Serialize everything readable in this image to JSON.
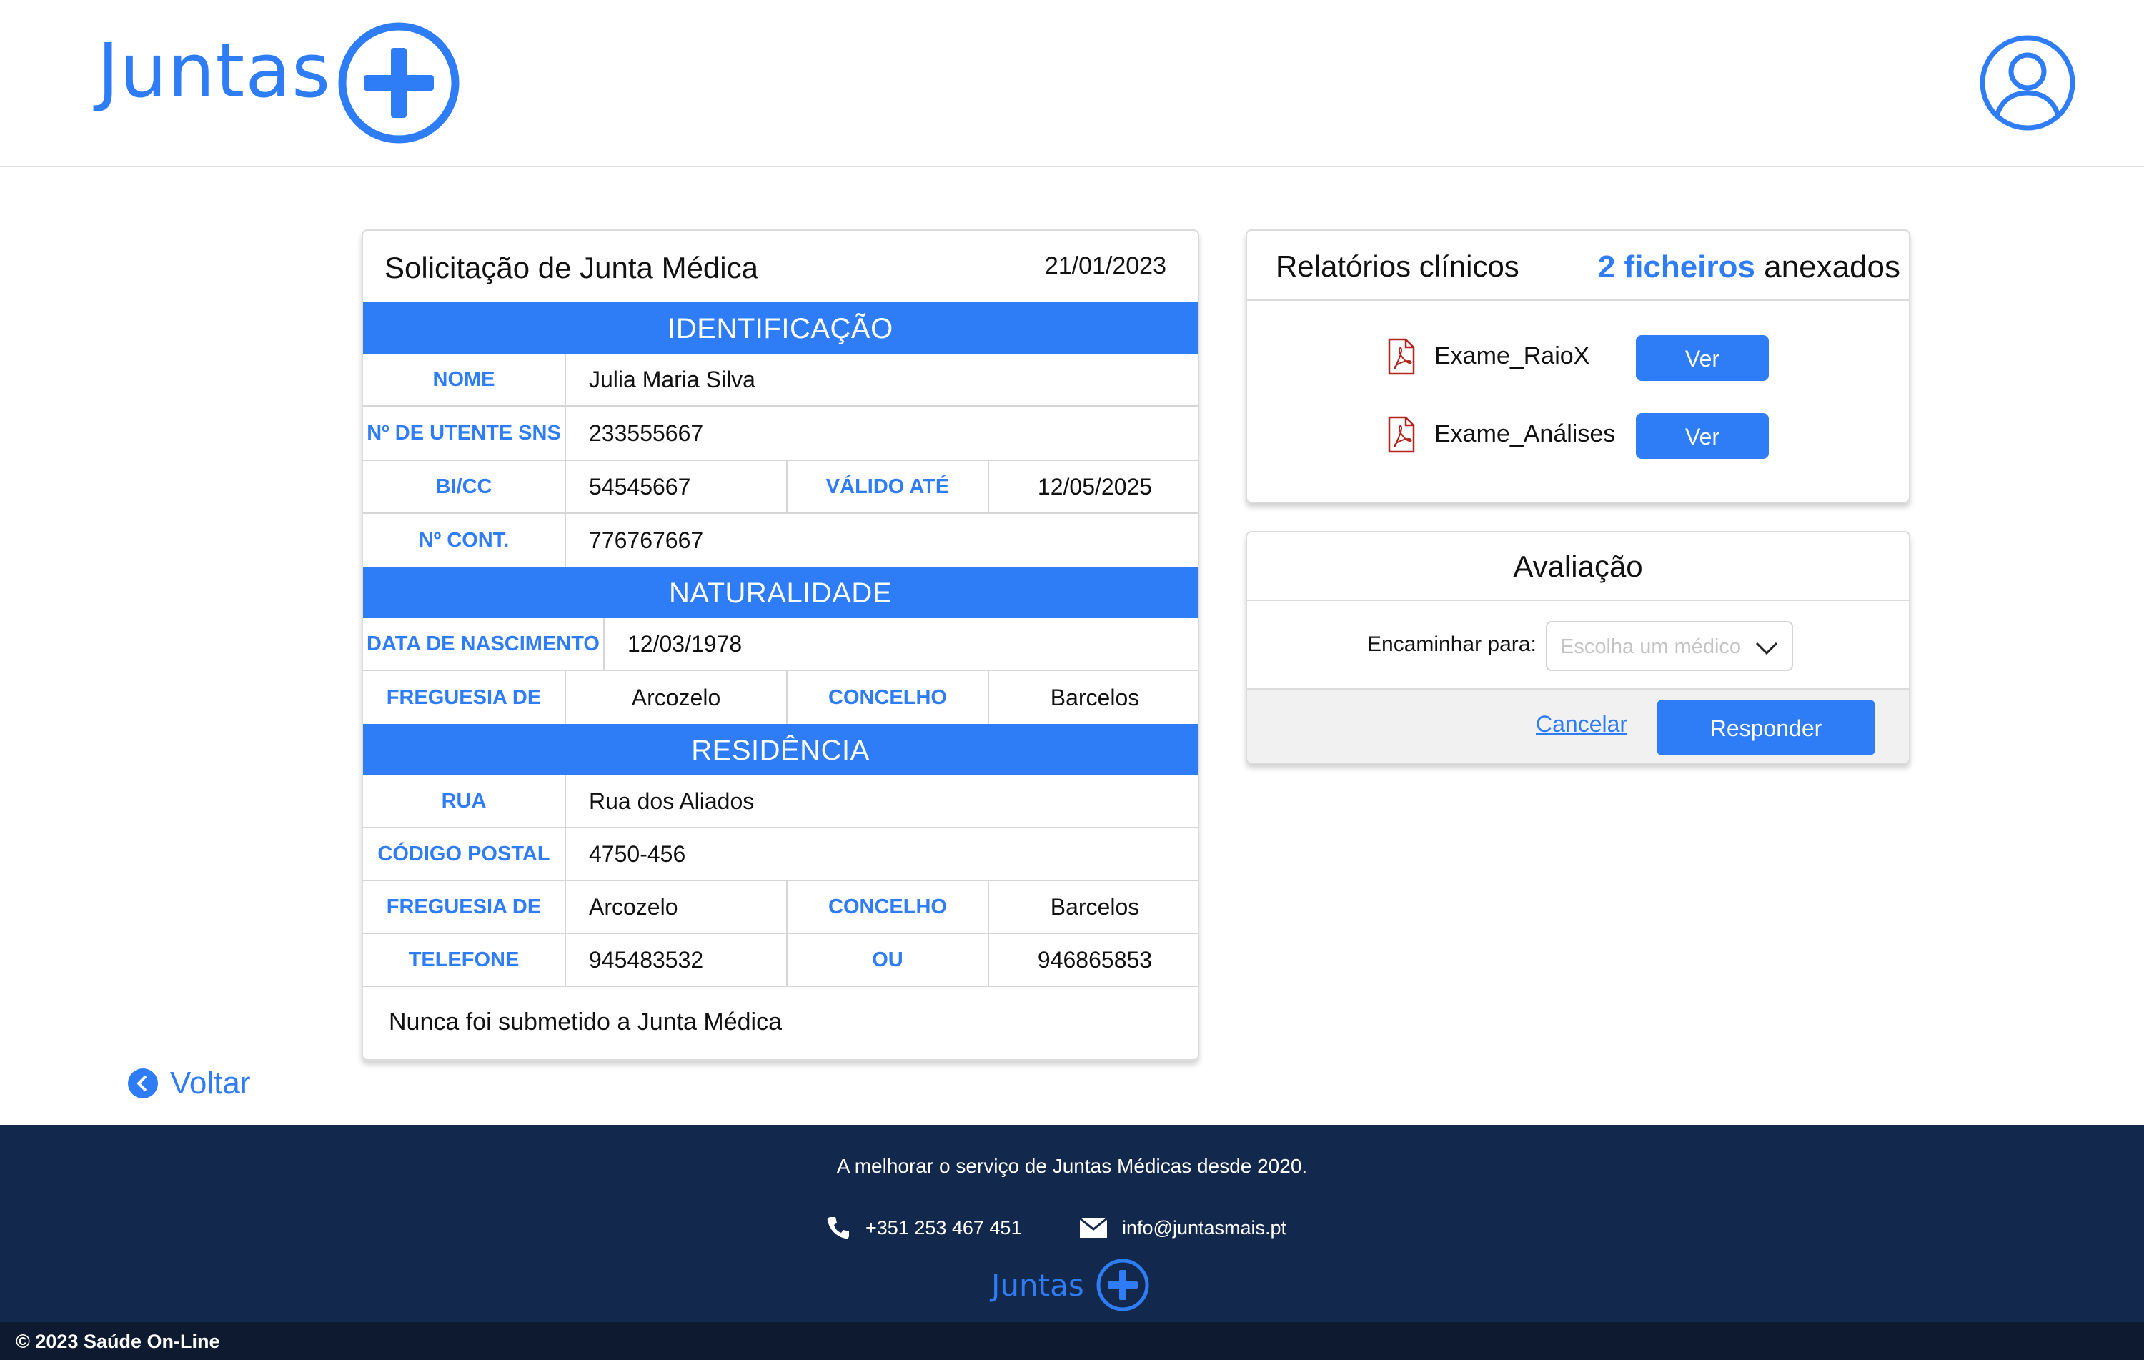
{
  "header": {
    "logo_text": "Juntas",
    "logo_icon": "plus-circle-icon",
    "profile_icon": "user-circle-icon"
  },
  "form": {
    "title": "Solicitação de Junta Médica",
    "date": "21/01/2023",
    "sections": {
      "identificacao": "IDENTIFICAÇÃO",
      "naturalidade": "NATURALIDADE",
      "residencia": "RESIDÊNCIA"
    },
    "fields": {
      "nome_label": "NOME",
      "nome_value": "Julia Maria Silva",
      "sns_label": "Nº DE UTENTE SNS",
      "sns_value": "233555667",
      "bicc_label": "BI/CC",
      "bicc_value": "54545667",
      "valido_label": "VÁLIDO ATÉ",
      "valido_value": "12/05/2025",
      "cont_label": "Nº CONT.",
      "cont_value": "776767667",
      "nascimento_label": "DATA DE NASCIMENTO",
      "nascimento_value": "12/03/1978",
      "nat_freguesia_label": "FREGUESIA DE",
      "nat_freguesia_value": "Arcozelo",
      "nat_concelho_label": "CONCELHO",
      "nat_concelho_value": "Barcelos",
      "rua_label": "RUA",
      "rua_value": "Rua dos Aliados",
      "postal_label": "CÓDIGO POSTAL",
      "postal_value": "4750-456",
      "res_freguesia_label": "FREGUESIA DE",
      "res_freguesia_value": "Arcozelo",
      "res_concelho_label": "CONCELHO",
      "res_concelho_value": "Barcelos",
      "telefone_label": "TELEFONE",
      "telefone_value": "945483532",
      "ou_label": "OU",
      "telefone2_value": "946865853"
    },
    "footnote": "Nunca foi submetido a Junta Médica"
  },
  "reports": {
    "title": "Relatórios clínicos",
    "count_highlight": "2 ficheiros",
    "count_suffix": "anexados",
    "files": [
      {
        "name": "Exame_RaioX",
        "button": "Ver",
        "icon": "pdf-icon"
      },
      {
        "name": "Exame_Análises",
        "button": "Ver",
        "icon": "pdf-icon"
      }
    ]
  },
  "evaluation": {
    "title": "Avaliação",
    "forward_label": "Encaminhar para:",
    "select_placeholder": "Escolha um médico",
    "cancel_label": "Cancelar",
    "respond_label": "Responder"
  },
  "back": {
    "label": "Voltar",
    "icon": "chevron-left-circle-icon"
  },
  "footer": {
    "tagline": "A melhorar o serviço de Juntas Médicas desde 2020.",
    "phone": "+351 253 467 451",
    "phone_icon": "phone-icon",
    "email": "info@juntasmais.pt",
    "email_icon": "envelope-icon",
    "logo_text": "Juntas",
    "copyright": "© 2023 Saúde On-Line"
  },
  "colors": {
    "accent": "#2e7cf6",
    "footer_bg": "#13284d",
    "bottom_bar": "#0d1a2f",
    "pdf_red": "#b3261e"
  }
}
